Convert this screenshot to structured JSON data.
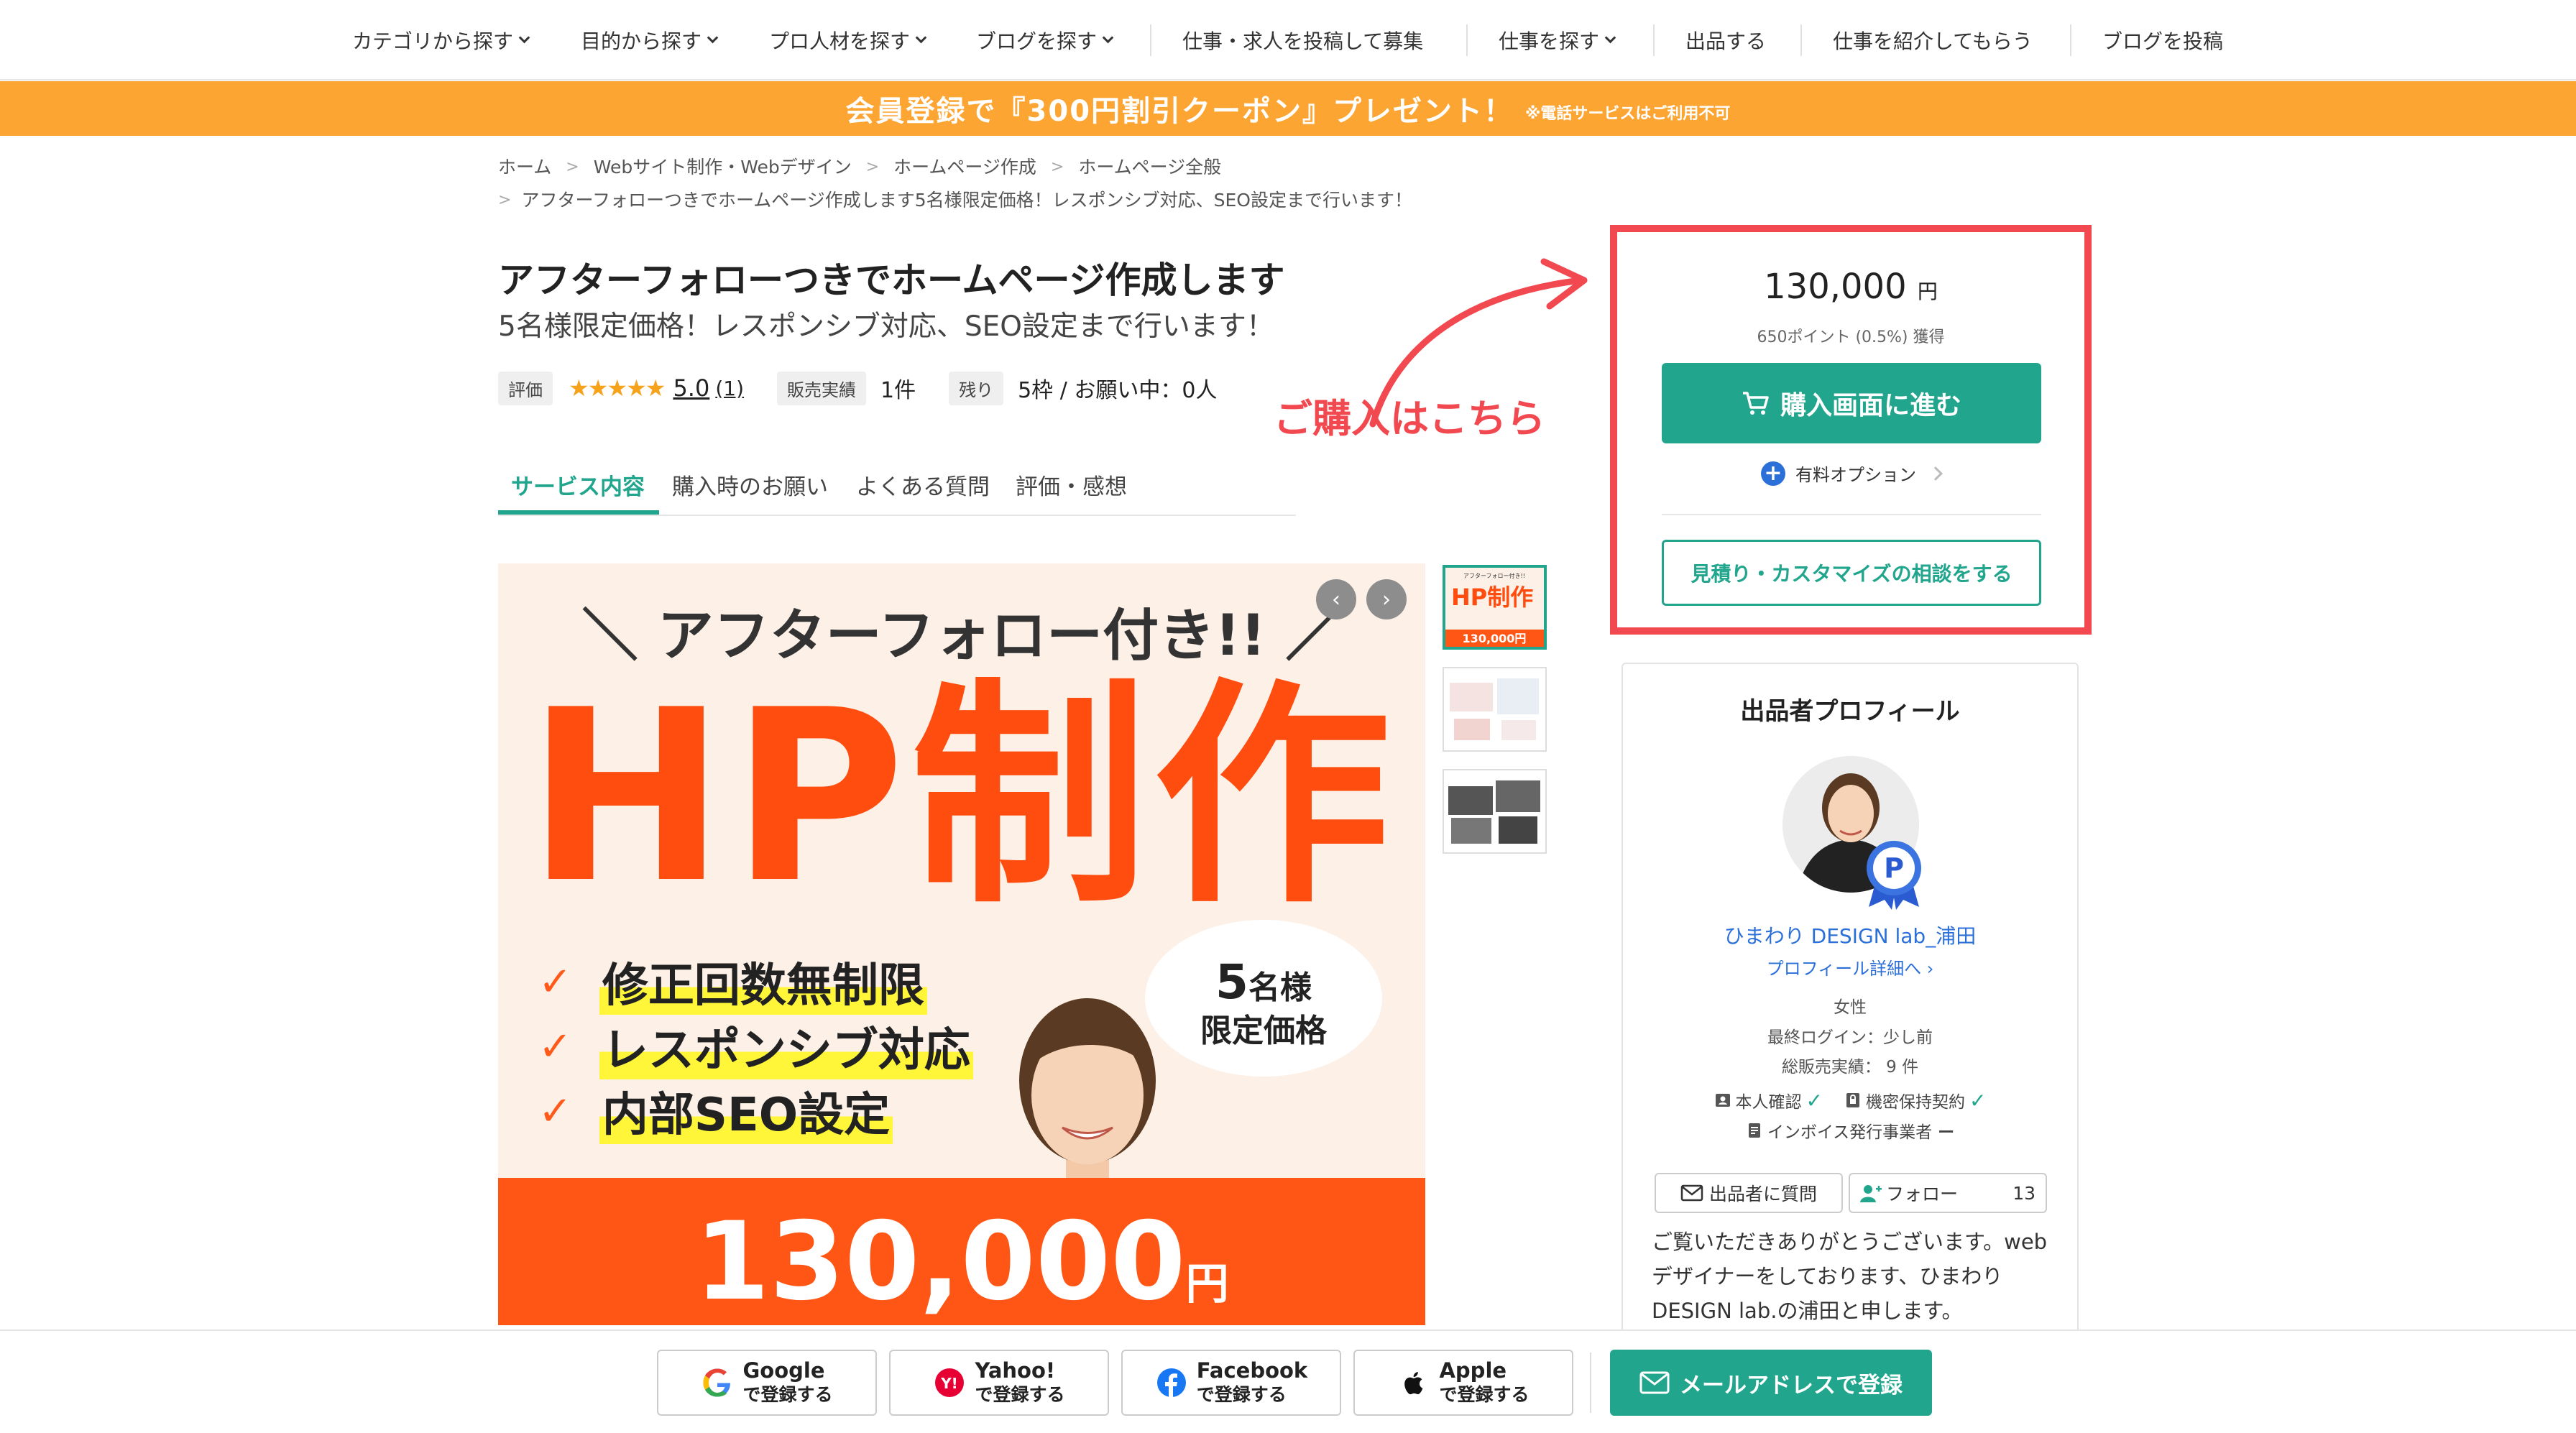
{
  "nav": {
    "items": [
      {
        "label": "カテゴリから探す"
      },
      {
        "label": "目的から探す"
      },
      {
        "label": "プロ人材を探す"
      },
      {
        "label": "ブログを探す"
      },
      {
        "label": "仕事・求人を投稿して募集"
      },
      {
        "label": "仕事を探す"
      },
      {
        "label": "出品する"
      },
      {
        "label": "仕事を紹介してもらう"
      },
      {
        "label": "ブログを投稿"
      }
    ]
  },
  "banner": {
    "main": "会員登録で『300円割引クーポン』プレゼント！",
    "note": "※電話サービスはご利用不可",
    "color": "#fda533"
  },
  "breadcrumb": {
    "items": [
      "ホーム",
      "Webサイト制作・Webデザイン",
      "ホームページ作成",
      "ホームページ全般"
    ],
    "current": "アフターフォローつきでホームページ作成します5名様限定価格！レスポンシブ対応、SEO設定まで行います！"
  },
  "service": {
    "title": "アフターフォローつきでホームページ作成します",
    "subtitle": "5名様限定価格！レスポンシブ対応、SEO設定まで行います！",
    "rating_label": "評価",
    "stars": "★★★★★",
    "rating": "5.0",
    "rating_count": "(1)",
    "sales_label": "販売実績",
    "sales": "1件",
    "remaining_label": "残り",
    "remaining": "5枠 / お願い中：0人"
  },
  "tabs": [
    {
      "label": "サービス内容",
      "active": true
    },
    {
      "label": "購入時のお願い"
    },
    {
      "label": "よくある質問"
    },
    {
      "label": "評価・感想"
    }
  ],
  "hero": {
    "tagline": "＼ アフターフォロー付き!! ／",
    "headline": "HP制作",
    "features": [
      "修正回数無制限",
      "レスポンシブ対応",
      "内部SEO設定"
    ],
    "bubble_num": "5",
    "bubble_line1": "名様",
    "bubble_line2": "限定価格",
    "price": "130,000",
    "price_unit": "円",
    "prev": "‹",
    "next": "›",
    "thumb_headline": "HP制作",
    "thumb_price": "130,000円",
    "thumb_tagline": "アフターフォロー付き!!"
  },
  "annotation": {
    "text": "ご購入はこちら",
    "color": "#f2484f"
  },
  "purchase": {
    "price": "130,000",
    "unit": "円",
    "points": "650ポイント (0.5%) 獲得",
    "buy_label": "購入画面に進む",
    "option_label": "有料オプション",
    "consult_label": "見積り・カスタマイズの相談をする",
    "accent": "#21a58d"
  },
  "seller": {
    "heading": "出品者プロフィール",
    "name": "ひまわり DESIGN lab_浦田",
    "detail_link": "プロフィール詳細へ",
    "gender": "女性",
    "last_login": "最終ログイン：少し前",
    "total_sales": "総販売実績： 9 件",
    "identity": "本人確認",
    "nda": "機密保持契約",
    "invoice": "インボイス発行事業者",
    "invoice_status": "ー",
    "ask_label": "出品者に質問",
    "follow_label": "フォロー",
    "follow_count": "13",
    "intro": "ご覧いただきありがとうございます。webデザイナーをしております、ひまわり DESIGN lab.の浦田と申します。",
    "badge": "P"
  },
  "register": {
    "buttons": [
      {
        "brand": "Google",
        "sub": "で登録する"
      },
      {
        "brand": "Yahoo!",
        "sub": "で登録する"
      },
      {
        "brand": "Facebook",
        "sub": "で登録する"
      },
      {
        "brand": "Apple",
        "sub": "で登録する"
      }
    ],
    "mail_label": "メールアドレスで登録"
  }
}
